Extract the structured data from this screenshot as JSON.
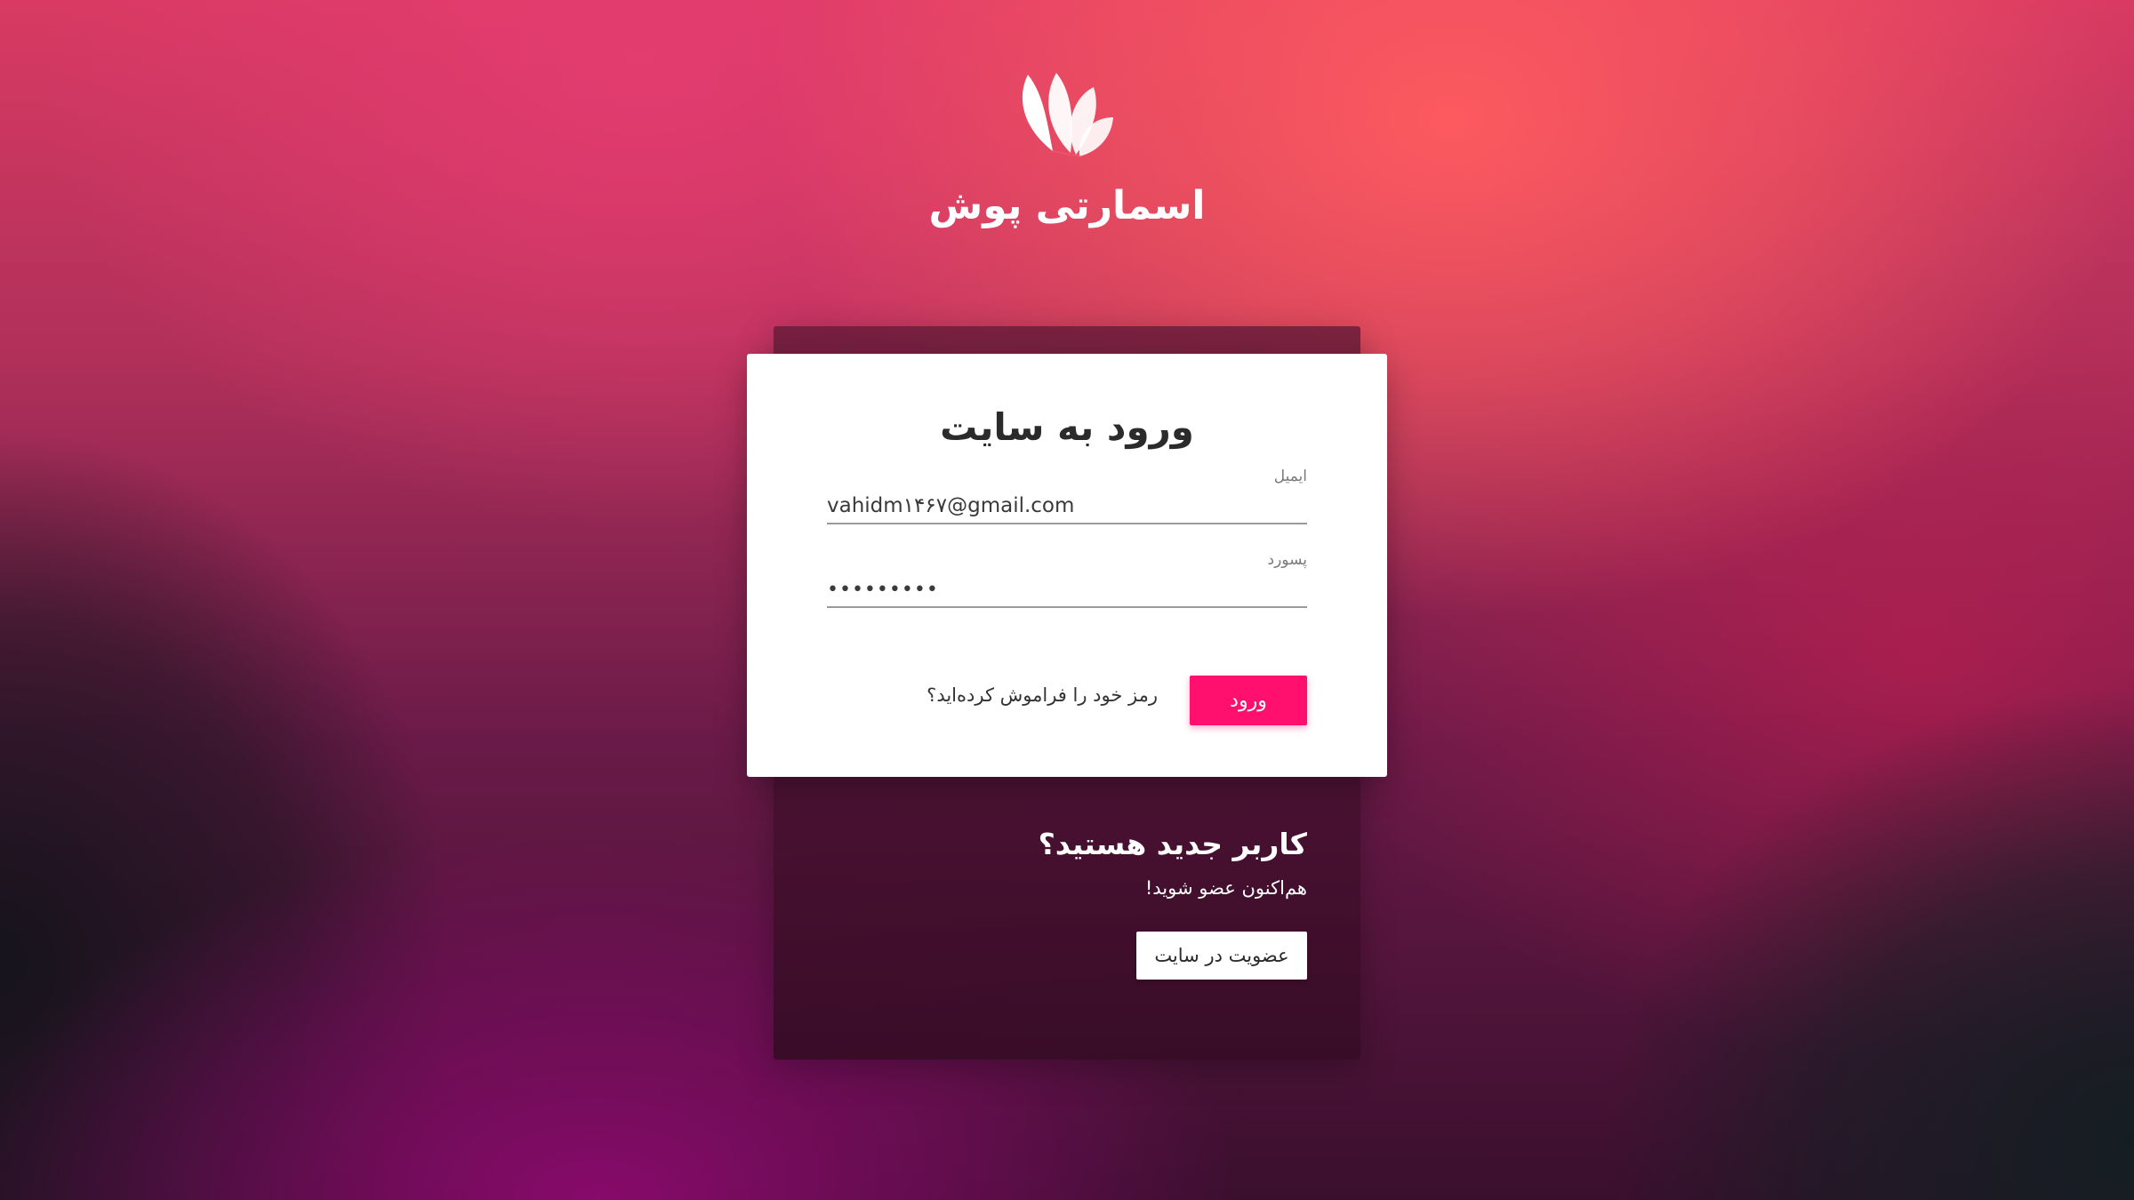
{
  "brand": {
    "name": "اسمارتی پوش",
    "logo_icon": "lotus-leaves-icon"
  },
  "login": {
    "title": "ورود به سایت",
    "email_label": "ایمیل",
    "email_value": "vahidm۱۴۶۷@gmail.com",
    "password_label": "پسورد",
    "password_value": "•••••••••",
    "submit_label": "ورود",
    "forgot_label": "رمز خود را فراموش کرده‌اید؟"
  },
  "signup": {
    "title": "کاربر جدید هستید؟",
    "subtitle": "هم‌اکنون عضو شوید!",
    "button_label": "عضویت در سایت"
  },
  "colors": {
    "accent": "#ff0f6e",
    "card_background": "#ffffff"
  }
}
